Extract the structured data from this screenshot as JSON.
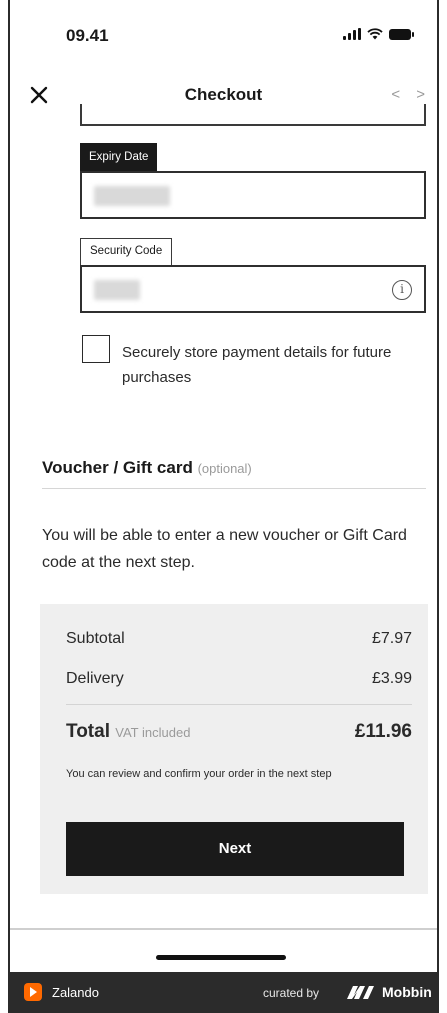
{
  "status_bar": {
    "time": "09.41"
  },
  "nav": {
    "title": "Checkout",
    "arrows": "< >"
  },
  "form": {
    "expiry_label": "Expiry Date",
    "security_label": "Security Code",
    "info_symbol": "i",
    "store_checkbox_label": "Securely store payment details for future purchases",
    "store_checkbox_checked": false
  },
  "voucher": {
    "title": "Voucher / Gift card",
    "optional": "(optional)",
    "description": "You will be able to enter a new voucher or Gift Card code at the next step."
  },
  "summary": {
    "subtotal_label": "Subtotal",
    "subtotal_value": "£7.97",
    "delivery_label": "Delivery",
    "delivery_value": "£3.99",
    "total_label": "Total",
    "vat_note": "VAT included",
    "total_value": "£11.96",
    "review_note": "You can review and confirm your order in the next step",
    "next_label": "Next"
  },
  "footer": {
    "brand": "Zalando",
    "curated_by": "curated by",
    "mobbin": "Mobbin",
    "brand_color": "#ff6900"
  },
  "icons": [
    "signal-icon",
    "wifi-icon",
    "battery-icon",
    "close-icon",
    "info-icon",
    "zalando-logo-icon",
    "mobbin-logo-icon"
  ]
}
